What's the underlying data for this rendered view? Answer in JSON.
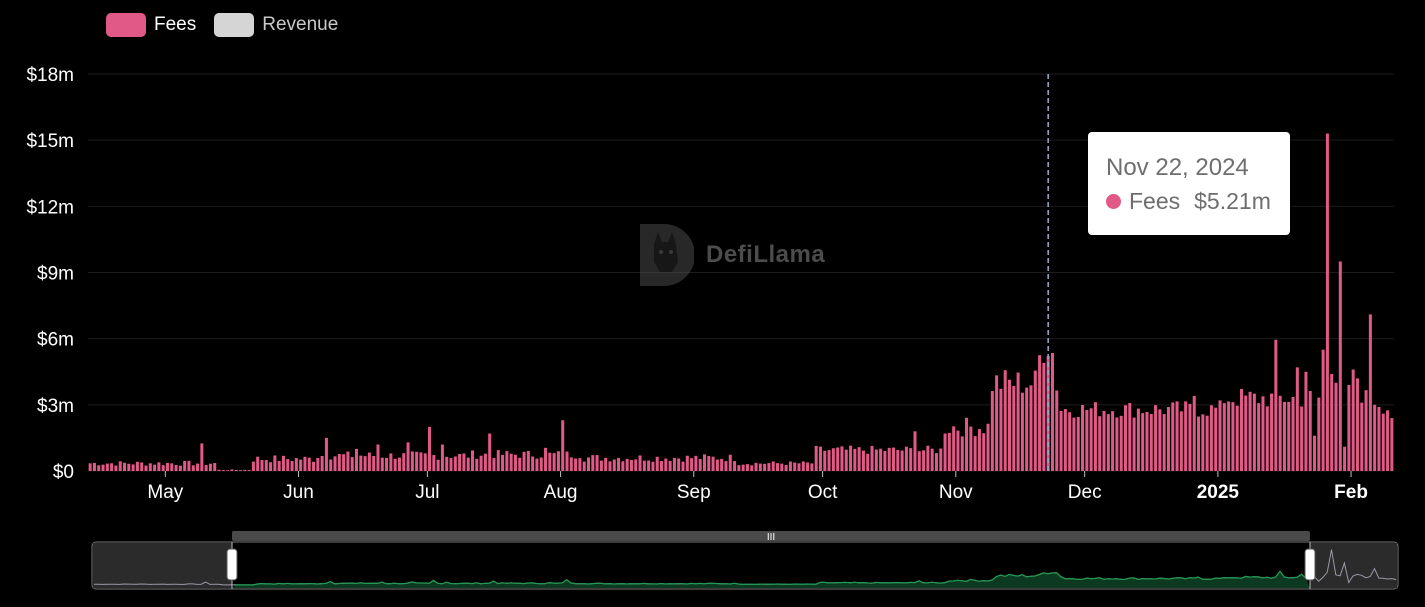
{
  "legend": {
    "fees_label": "Fees",
    "revenue_label": "Revenue"
  },
  "watermark": {
    "text": "DefiLlama"
  },
  "tooltip": {
    "date": "Nov 22, 2024",
    "series": "Fees",
    "value": "$5.21m"
  },
  "colors": {
    "fees": "#e05987",
    "revenue": "#d5d5d5",
    "grid": "#1c1c1c",
    "navigator_line": "#1f9a52",
    "navigator_fill": "#0c3a20",
    "navigator_handle": "#ffffff",
    "cursor_line": "#9aa7c7"
  },
  "chart_data": {
    "type": "bar",
    "x_start": "2024-04-13",
    "x_end": "2025-02-10",
    "ylim": [
      0,
      18
    ],
    "y_unit": "$m",
    "yticks": [
      "$0",
      "$3m",
      "$6m",
      "$9m",
      "$12m",
      "$15m",
      "$18m"
    ],
    "xticks": [
      {
        "date": "2024-05-01",
        "label": "May",
        "bold": false
      },
      {
        "date": "2024-06-01",
        "label": "Jun",
        "bold": false
      },
      {
        "date": "2024-07-01",
        "label": "Jul",
        "bold": false
      },
      {
        "date": "2024-08-01",
        "label": "Aug",
        "bold": false
      },
      {
        "date": "2024-09-01",
        "label": "Sep",
        "bold": false
      },
      {
        "date": "2024-10-01",
        "label": "Oct",
        "bold": false
      },
      {
        "date": "2024-11-01",
        "label": "Nov",
        "bold": false
      },
      {
        "date": "2024-12-01",
        "label": "Dec",
        "bold": false
      },
      {
        "date": "2025-01-01",
        "label": "2025",
        "bold": true
      },
      {
        "date": "2025-02-01",
        "label": "Feb",
        "bold": true
      }
    ],
    "grid": true,
    "legend_position": "top-left",
    "highlight_date": "2024-11-22",
    "series": [
      {
        "name": "Fees",
        "color": "#e05987",
        "segments": [
          {
            "from": "2024-04-13",
            "to": "2024-05-12",
            "base": 0.35,
            "jitter": 0.12
          },
          {
            "from": "2024-05-13",
            "to": "2024-05-20",
            "base": 0.05,
            "jitter": 0.02
          },
          {
            "from": "2024-05-21",
            "to": "2024-06-04",
            "base": 0.55,
            "jitter": 0.18
          },
          {
            "from": "2024-06-05",
            "to": "2024-07-10",
            "base": 0.7,
            "jitter": 0.2
          },
          {
            "from": "2024-07-11",
            "to": "2024-08-05",
            "base": 0.75,
            "jitter": 0.2
          },
          {
            "from": "2024-08-06",
            "to": "2024-09-10",
            "base": 0.6,
            "jitter": 0.18
          },
          {
            "from": "2024-09-11",
            "to": "2024-09-28",
            "base": 0.35,
            "jitter": 0.1
          },
          {
            "from": "2024-09-29",
            "to": "2024-10-28",
            "base": 0.95,
            "jitter": 0.2
          },
          {
            "from": "2024-10-29",
            "to": "2024-11-08",
            "base": 2.0,
            "jitter": 0.45
          },
          {
            "from": "2024-11-09",
            "to": "2024-11-24",
            "base": 4.0,
            "jitter": 0.7
          },
          {
            "from": "2024-11-25",
            "to": "2024-12-31",
            "base": 2.8,
            "jitter": 0.4
          },
          {
            "from": "2025-01-01",
            "to": "2025-02-10",
            "base": 3.3,
            "jitter": 0.5
          }
        ],
        "spikes": [
          {
            "date": "2024-05-09",
            "value": 1.25
          },
          {
            "date": "2024-06-07",
            "value": 1.5
          },
          {
            "date": "2024-06-14",
            "value": 1.0
          },
          {
            "date": "2024-06-19",
            "value": 1.2
          },
          {
            "date": "2024-06-26",
            "value": 1.3
          },
          {
            "date": "2024-07-01",
            "value": 2.0
          },
          {
            "date": "2024-07-04",
            "value": 1.2
          },
          {
            "date": "2024-07-15",
            "value": 1.7
          },
          {
            "date": "2024-07-28",
            "value": 1.05
          },
          {
            "date": "2024-08-01",
            "value": 2.3
          },
          {
            "date": "2024-10-22",
            "value": 1.8
          },
          {
            "date": "2024-11-20",
            "value": 5.25
          },
          {
            "date": "2024-11-21",
            "value": 4.9
          },
          {
            "date": "2024-11-22",
            "value": 5.21
          },
          {
            "date": "2024-11-23",
            "value": 5.35
          },
          {
            "date": "2024-12-26",
            "value": 3.4
          },
          {
            "date": "2025-01-01",
            "value": 3.2
          },
          {
            "date": "2025-01-14",
            "value": 5.95
          },
          {
            "date": "2025-01-19",
            "value": 4.7
          },
          {
            "date": "2025-01-21",
            "value": 4.5
          },
          {
            "date": "2025-01-23",
            "value": 1.6
          },
          {
            "date": "2025-01-25",
            "value": 5.5
          },
          {
            "date": "2025-01-26",
            "value": 15.3
          },
          {
            "date": "2025-01-27",
            "value": 4.4
          },
          {
            "date": "2025-01-28",
            "value": 4.0
          },
          {
            "date": "2025-01-29",
            "value": 9.5
          },
          {
            "date": "2025-01-30",
            "value": 1.1
          },
          {
            "date": "2025-01-31",
            "value": 3.9
          },
          {
            "date": "2025-02-01",
            "value": 4.6
          },
          {
            "date": "2025-02-02",
            "value": 4.2
          },
          {
            "date": "2025-02-03",
            "value": 3.1
          },
          {
            "date": "2025-02-05",
            "value": 7.1
          },
          {
            "date": "2025-02-06",
            "value": 3.0
          },
          {
            "date": "2025-02-07",
            "value": 2.9
          },
          {
            "date": "2025-02-08",
            "value": 2.6
          },
          {
            "date": "2025-02-09",
            "value": 2.75
          },
          {
            "date": "2025-02-10",
            "value": 2.4
          }
        ]
      }
    ],
    "navigator": {
      "window_from": "2024-04-13",
      "window_to": "2025-02-10"
    }
  }
}
